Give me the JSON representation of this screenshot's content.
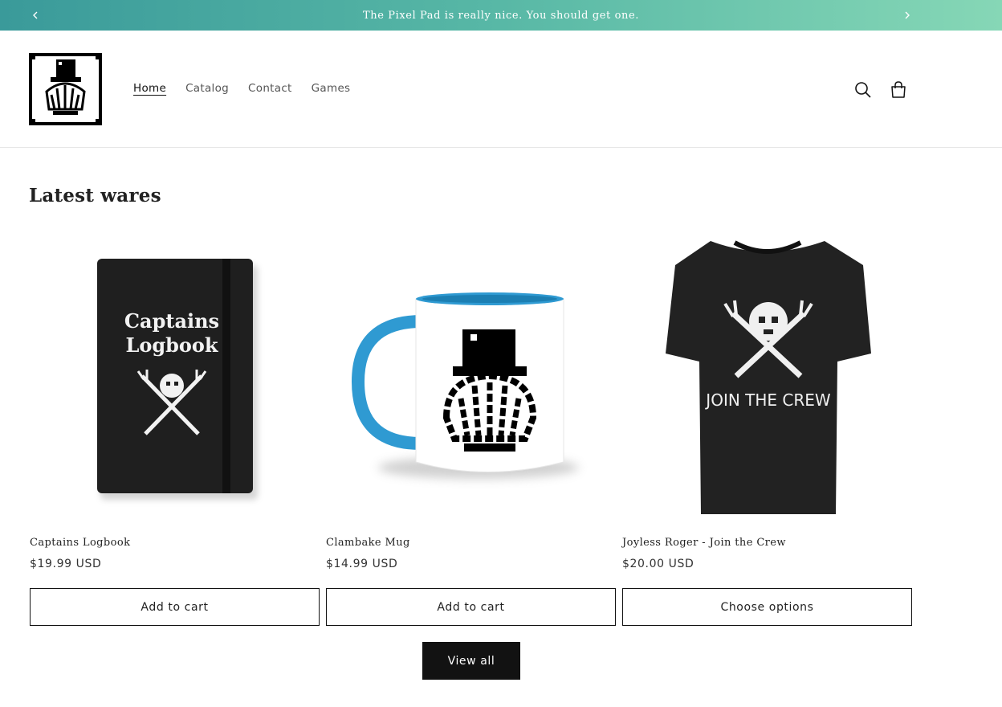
{
  "announcement": {
    "message": "The Pixel Pad is really nice. You should get one.",
    "prev_icon": "chevron-left-icon",
    "next_icon": "chevron-right-icon"
  },
  "header": {
    "logo_icon": "clam-top-hat-logo",
    "nav": [
      {
        "label": "Home",
        "active": true
      },
      {
        "label": "Catalog",
        "active": false
      },
      {
        "label": "Contact",
        "active": false
      },
      {
        "label": "Games",
        "active": false
      }
    ],
    "search_icon": "search-icon",
    "cart_icon": "cart-icon"
  },
  "section": {
    "title": "Latest wares",
    "products": [
      {
        "name": "Captains Logbook",
        "price": "$19.99 USD",
        "button": "Add to cart",
        "image_text": [
          "Captains",
          "Logbook"
        ]
      },
      {
        "name": "Clambake Mug",
        "price": "$14.99 USD",
        "button": "Add to cart"
      },
      {
        "name": "Joyless Roger - Join the Crew",
        "price": "$20.00 USD",
        "button": "Choose options",
        "image_text": "JOIN THE CREW"
      }
    ],
    "view_all": "View all"
  },
  "colors": {
    "announcement_gradient_start": "#3a9a9a",
    "announcement_gradient_end": "#86d7b6",
    "text": "#121212",
    "button_dark": "#121212",
    "mug_accent": "#2f9ad2"
  }
}
